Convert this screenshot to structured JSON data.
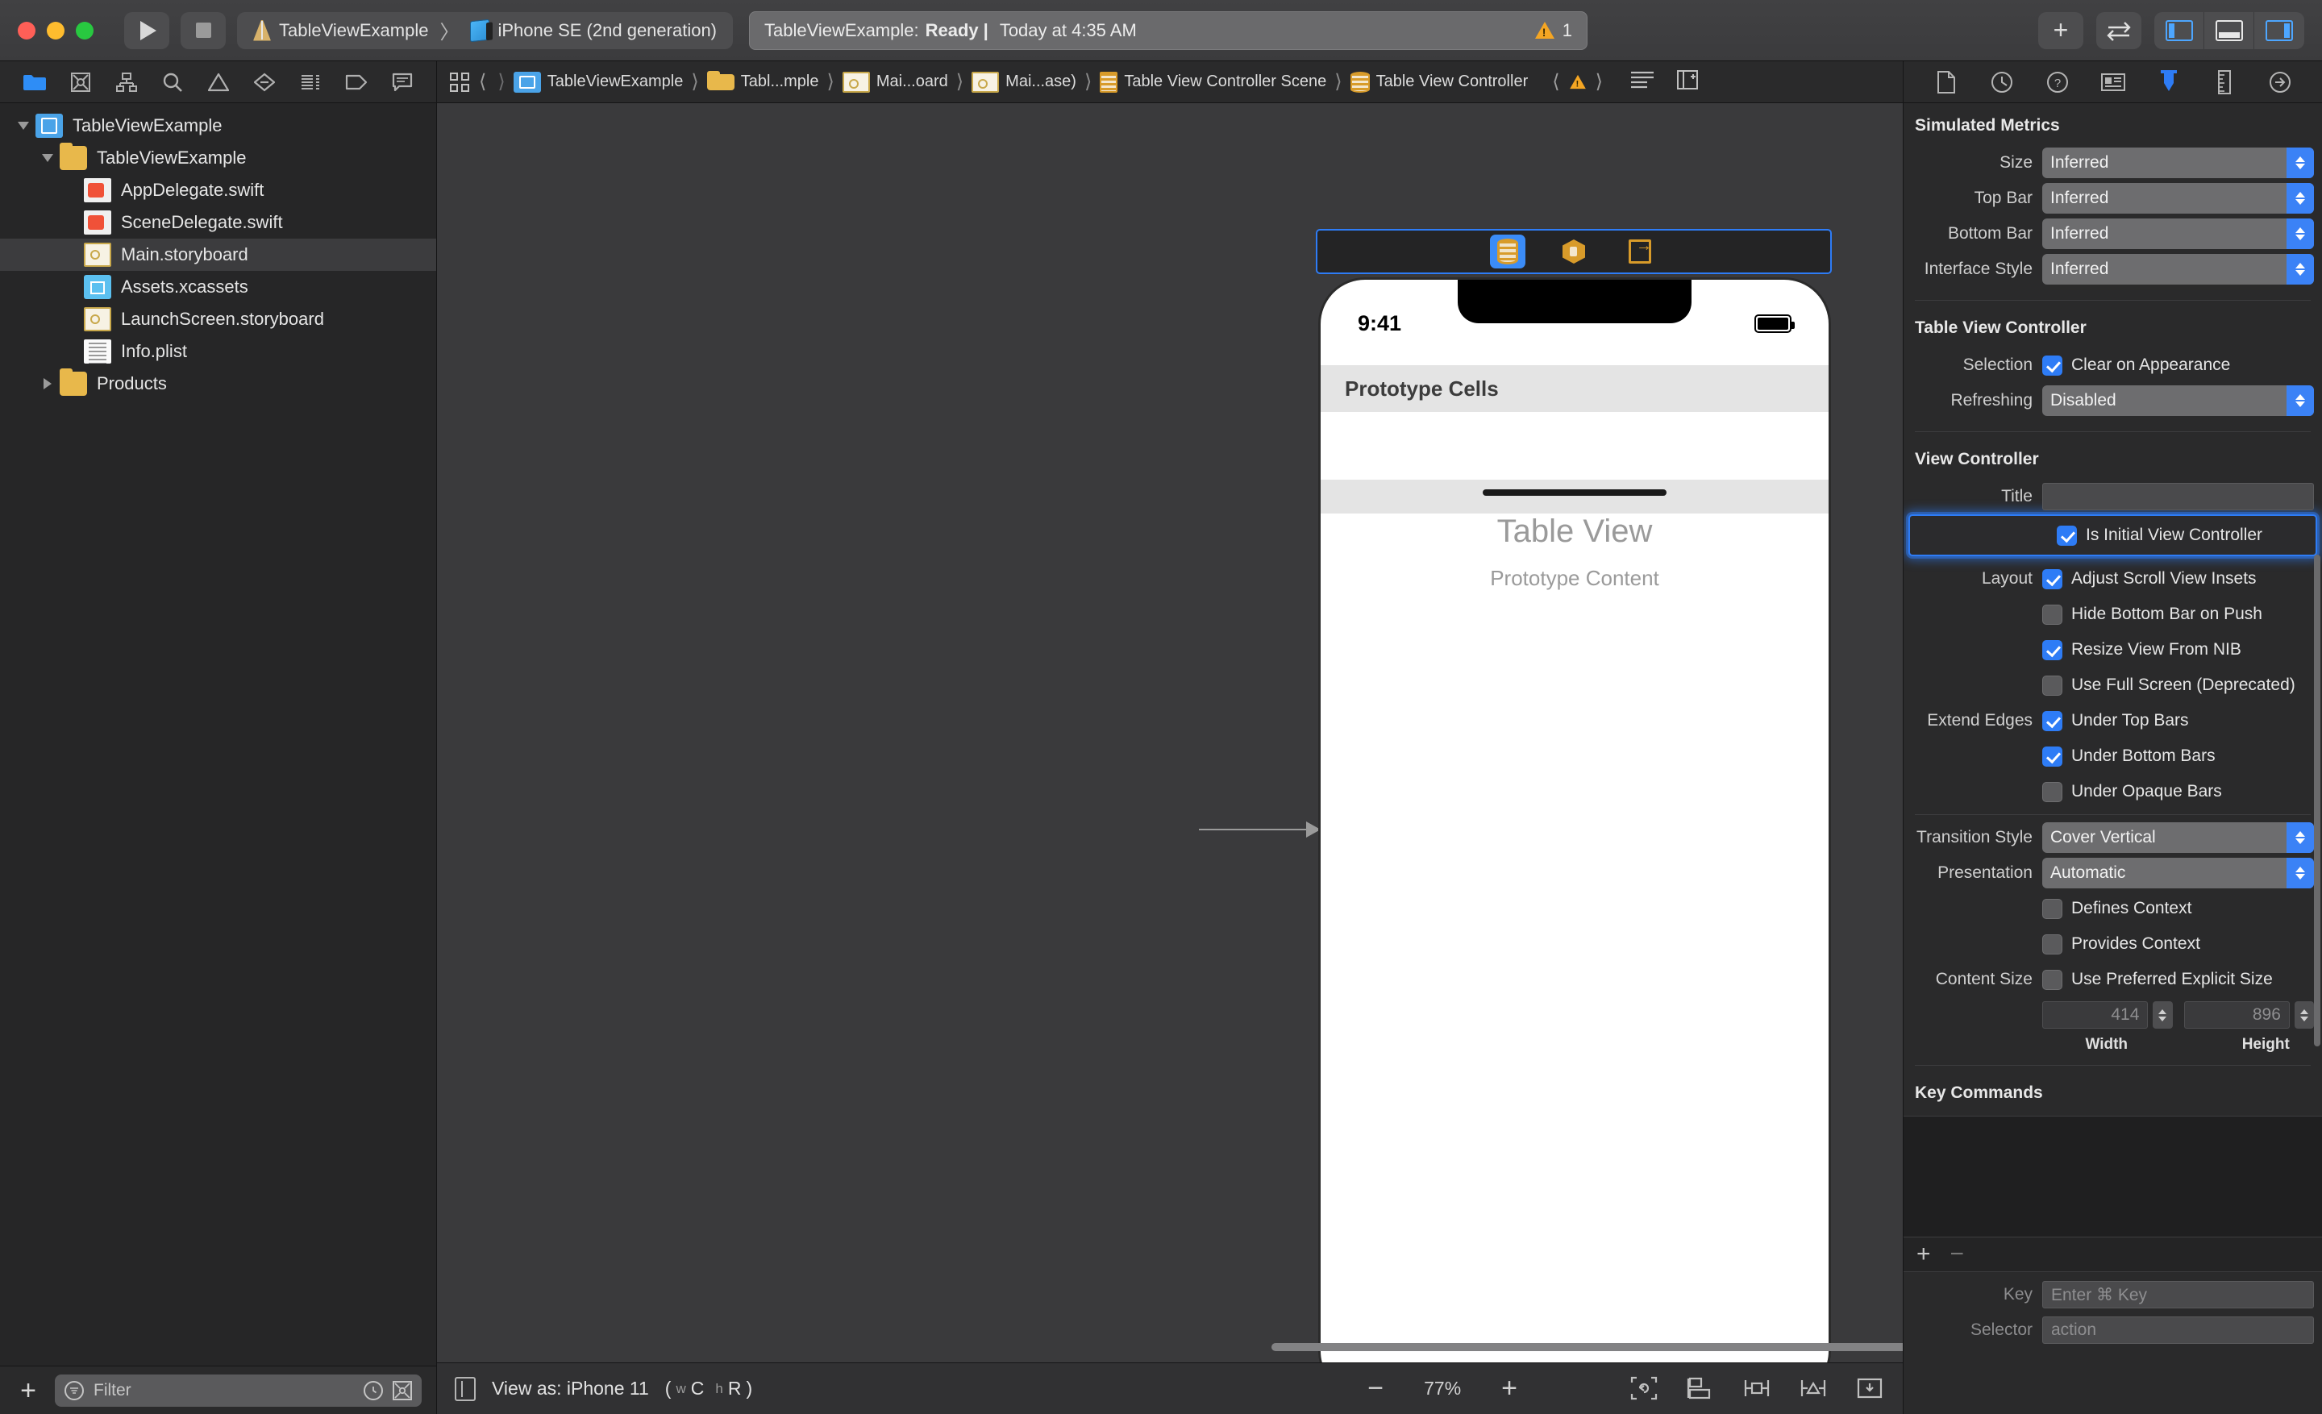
{
  "toolbar": {
    "run_label": "run-button",
    "stop_label": "stop-button",
    "scheme_project": "TableViewExample",
    "scheme_separator": "〉",
    "scheme_destination": "iPhone SE (2nd generation)",
    "status_prefix": "TableViewExample:",
    "status_state": "Ready",
    "status_pipe": "|",
    "status_time": "Today at 4:35 AM",
    "warning_count": "1",
    "add_label": "+",
    "library_label": "⇄"
  },
  "navigator": {
    "tabs": [
      "folder-icon",
      "source-control-icon",
      "hierarchy-icon",
      "search-icon",
      "warning-icon",
      "breakpoint-icon",
      "report-icon",
      "tag-icon",
      "comment-icon"
    ],
    "tree": [
      {
        "label": "TableViewExample",
        "icon": "xcode-project-icon",
        "indent": 0,
        "twisty": "down",
        "selected": false
      },
      {
        "label": "TableViewExample",
        "icon": "folder-icon",
        "indent": 1,
        "twisty": "down",
        "selected": false
      },
      {
        "label": "AppDelegate.swift",
        "icon": "swift-file-icon",
        "indent": 2,
        "twisty": "none",
        "selected": false
      },
      {
        "label": "SceneDelegate.swift",
        "icon": "swift-file-icon",
        "indent": 2,
        "twisty": "none",
        "selected": false
      },
      {
        "label": "Main.storyboard",
        "icon": "storyboard-icon",
        "indent": 2,
        "twisty": "none",
        "selected": true
      },
      {
        "label": "Assets.xcassets",
        "icon": "assets-icon",
        "indent": 2,
        "twisty": "none",
        "selected": false
      },
      {
        "label": "LaunchScreen.storyboard",
        "icon": "storyboard-icon",
        "indent": 2,
        "twisty": "none",
        "selected": false
      },
      {
        "label": "Info.plist",
        "icon": "plist-icon",
        "indent": 2,
        "twisty": "none",
        "selected": false
      },
      {
        "label": "Products",
        "icon": "folder-icon",
        "indent": 1,
        "twisty": "right",
        "selected": false
      }
    ],
    "filter_placeholder": "Filter",
    "add_label": "+"
  },
  "jumpbar": {
    "crumbs": [
      {
        "label": "TableViewExample",
        "icon": "project-icon"
      },
      {
        "label": "Tabl...mple",
        "icon": "folder-icon"
      },
      {
        "label": "Mai...oard",
        "icon": "storyboard-icon"
      },
      {
        "label": "Mai...ase)",
        "icon": "storyboard-icon"
      },
      {
        "label": "Table View Controller Scene",
        "icon": "scene-icon"
      },
      {
        "label": "Table View Controller",
        "icon": "view-controller-icon"
      }
    ]
  },
  "canvas": {
    "dock_items": [
      "table-view-controller-icon",
      "first-responder-icon",
      "exit-icon"
    ],
    "device": {
      "time": "9:41",
      "section_header": "Prototype Cells",
      "placeholder_title": "Table View",
      "placeholder_subtitle": "Prototype Content"
    },
    "bottom_bar": {
      "view_as_label": "View as: iPhone 11",
      "trait_w": "w",
      "trait_wc": "C",
      "trait_h": "h",
      "trait_hr": "R",
      "paren_open": "(",
      "paren_close": ")",
      "zoom_out": "−",
      "zoom_level": "77%",
      "zoom_in": "+"
    }
  },
  "inspector": {
    "tabs": [
      "file-inspector-icon",
      "history-inspector-icon",
      "quick-help-icon",
      "identity-inspector-icon",
      "attributes-inspector-icon",
      "size-inspector-icon",
      "connections-inspector-icon"
    ],
    "simulated_metrics": {
      "title": "Simulated Metrics",
      "rows": [
        {
          "label": "Size",
          "value": "Inferred"
        },
        {
          "label": "Top Bar",
          "value": "Inferred"
        },
        {
          "label": "Bottom Bar",
          "value": "Inferred"
        },
        {
          "label": "Interface Style",
          "value": "Inferred"
        }
      ]
    },
    "table_view_controller": {
      "title": "Table View Controller",
      "selection_label": "Selection",
      "selection_checkbox": "Clear on Appearance",
      "selection_checked": true,
      "refreshing_label": "Refreshing",
      "refreshing_value": "Disabled"
    },
    "view_controller": {
      "title": "View Controller",
      "title_label": "Title",
      "title_value": "",
      "is_initial_label": "Is Initial View Controller",
      "is_initial_checked": true,
      "layout_label": "Layout",
      "layout_rows": [
        {
          "label": "Adjust Scroll View Insets",
          "checked": true
        },
        {
          "label": "Hide Bottom Bar on Push",
          "checked": false
        },
        {
          "label": "Resize View From NIB",
          "checked": true
        },
        {
          "label": "Use Full Screen (Deprecated)",
          "checked": false
        }
      ],
      "extend_edges_label": "Extend Edges",
      "extend_rows": [
        {
          "label": "Under Top Bars",
          "checked": true
        },
        {
          "label": "Under Bottom Bars",
          "checked": true
        },
        {
          "label": "Under Opaque Bars",
          "checked": false
        }
      ],
      "transition_label": "Transition Style",
      "transition_value": "Cover Vertical",
      "presentation_label": "Presentation",
      "presentation_value": "Automatic",
      "context_rows": [
        {
          "label": "Defines Context",
          "checked": false
        },
        {
          "label": "Provides Context",
          "checked": false
        }
      ],
      "content_size_label": "Content Size",
      "content_size_checkbox": "Use Preferred Explicit Size",
      "content_size_checked": false,
      "width_value": "414",
      "height_value": "896",
      "width_caption": "Width",
      "height_caption": "Height"
    },
    "key_commands": {
      "title": "Key Commands",
      "add_label": "+",
      "remove_label": "−",
      "key_label": "Key",
      "key_placeholder": "Enter ⌘ Key",
      "selector_label": "Selector",
      "selector_value": "action"
    }
  },
  "colors": {
    "accent_blue": "#2e7cf6",
    "window_bg": "#3a3a3c",
    "panel_bg": "#2a2a2b",
    "warning_orange": "#f5a623"
  }
}
